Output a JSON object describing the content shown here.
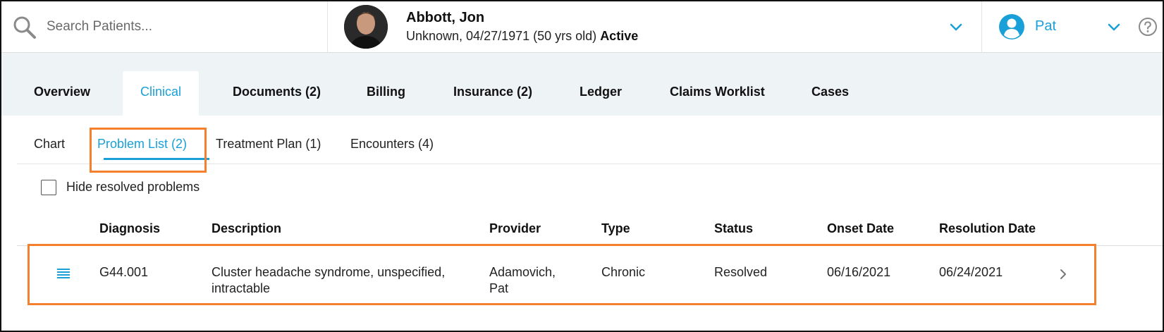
{
  "header": {
    "search": {
      "placeholder": "Search Patients..."
    },
    "patient": {
      "name": "Abbott, Jon",
      "details": "Unknown, 04/27/1971 (50 yrs old)",
      "status": "Active"
    },
    "user": {
      "name": "Pat"
    }
  },
  "primary_tabs": [
    {
      "label": "Overview",
      "active": false
    },
    {
      "label": "Clinical",
      "active": true
    },
    {
      "label": "Documents (2)",
      "active": false
    },
    {
      "label": "Billing",
      "active": false
    },
    {
      "label": "Insurance (2)",
      "active": false
    },
    {
      "label": "Ledger",
      "active": false
    },
    {
      "label": "Claims Worklist",
      "active": false
    },
    {
      "label": "Cases",
      "active": false
    }
  ],
  "sub_tabs": [
    {
      "label": "Chart",
      "active": false
    },
    {
      "label": "Problem List (2)",
      "active": true
    },
    {
      "label": "Treatment Plan (1)",
      "active": false
    },
    {
      "label": "Encounters (4)",
      "active": false
    }
  ],
  "filters": {
    "hide_resolved_label": "Hide resolved problems",
    "hide_resolved_checked": false
  },
  "table": {
    "columns": [
      "Diagnosis",
      "Description",
      "Provider",
      "Type",
      "Status",
      "Onset Date",
      "Resolution Date"
    ],
    "rows": [
      {
        "diagnosis": "G44.001",
        "description_line1": "Cluster headache syndrome, unspecified,",
        "description_line2": "intractable",
        "provider_line1": "Adamovich,",
        "provider_line2": "Pat",
        "type": "Chronic",
        "status": "Resolved",
        "onset_date": "06/16/2021",
        "resolution_date": "06/24/2021"
      }
    ]
  },
  "colors": {
    "accent": "#1aa0d8",
    "highlight": "#f47f2c",
    "tab_bar_bg": "#eef3f6"
  },
  "icons": {
    "search": "search-icon",
    "patient_dropdown": "chevron-down-icon",
    "user": "user-circle-icon",
    "user_dropdown": "chevron-down-icon",
    "help": "help-circle-icon",
    "row_menu": "menu-lines-icon",
    "row_open": "chevron-right-icon"
  }
}
